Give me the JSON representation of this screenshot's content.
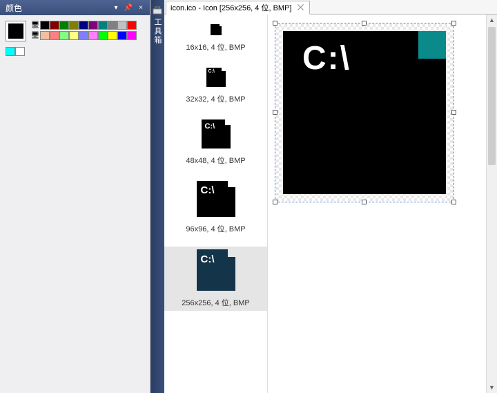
{
  "color_panel": {
    "title": "颜色",
    "pin_icon": "📌",
    "close_icon": "×",
    "monitor_icon": "🖥",
    "palette_row1": [
      "#000000",
      "#800000",
      "#008000",
      "#808000",
      "#000080",
      "#800080",
      "#008080",
      "#808080",
      "#c0c0c0",
      "#ff0000"
    ],
    "palette_row2": [
      "#f0c0a0",
      "#ff8080",
      "#80ff80",
      "#ffff80",
      "#8080ff",
      "#ff80ff",
      "#00ff00",
      "#ffff00",
      "#0000ff",
      "#ff00ff"
    ],
    "palette_row3": [
      "#00ffff",
      "#ffffff"
    ]
  },
  "toolbox_tab": {
    "icon": "🛠",
    "label": "工具箱"
  },
  "document_tab": {
    "title": "icon.ico - Icon [256x256, 4 位, BMP]",
    "close": "⨉"
  },
  "thumbnails": [
    {
      "label": "16x16, 4 位, BMP",
      "w": 16,
      "h": 16,
      "selected": false
    },
    {
      "label": "32x32, 4 位, BMP",
      "w": 28,
      "h": 28,
      "selected": false
    },
    {
      "label": "48x48, 4 位, BMP",
      "w": 42,
      "h": 42,
      "selected": false
    },
    {
      "label": "96x96, 4 位, BMP",
      "w": 56,
      "h": 52,
      "selected": false
    },
    {
      "label": "256x256, 4 位, BMP",
      "w": 56,
      "h": 60,
      "selected": true,
      "dark": true
    }
  ],
  "icon_text": "C:\\",
  "scrollbar": {
    "up": "▲",
    "down": "▼"
  }
}
